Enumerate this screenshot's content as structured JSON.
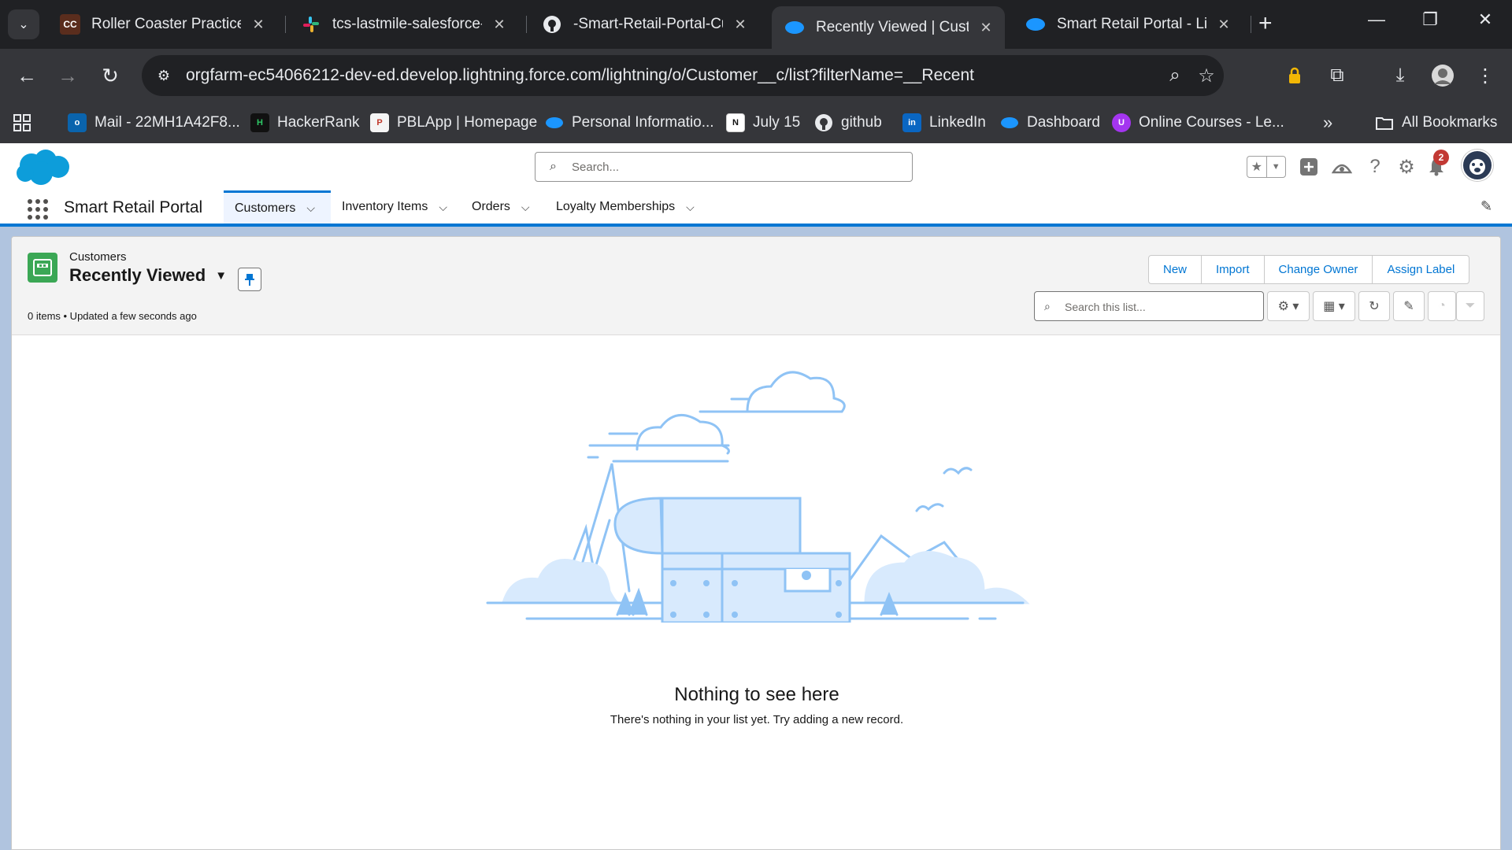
{
  "browser": {
    "tabs": [
      {
        "title": "Roller Coaster Practice Pr",
        "favicon": "CC",
        "close": "✕"
      },
      {
        "title": "tcs-lastmile-salesforce-ba",
        "favicon": "slack-icon",
        "close": "✕"
      },
      {
        "title": "-Smart-Retail-Portal-Cust",
        "favicon": "github-icon",
        "close": "✕"
      },
      {
        "title": "Recently Viewed | Custon",
        "favicon": "salesforce-icon",
        "close": "✕"
      },
      {
        "title": "Smart Retail Portal - Ligh",
        "favicon": "salesforce-icon",
        "close": "✕"
      }
    ],
    "new_tab": "+",
    "url": "orgfarm-ec54066212-dev-ed.develop.lightning.force.com/lightning/o/Customer__c/list?filterName=__Recent",
    "bookmarks": [
      {
        "label": "Mail - 22MH1A42F8..."
      },
      {
        "label": "HackerRank"
      },
      {
        "label": "PBLApp | Homepage"
      },
      {
        "label": "Personal Informatio..."
      },
      {
        "label": "July 15"
      },
      {
        "label": "github"
      },
      {
        "label": "LinkedIn"
      },
      {
        "label": "Dashboard"
      },
      {
        "label": "Online Courses - Le..."
      }
    ],
    "bookmarks_overflow": "»",
    "all_bookmarks": "All Bookmarks"
  },
  "sf": {
    "search_placeholder": "Search...",
    "notification_count": "2",
    "app_name": "Smart Retail Portal",
    "nav": [
      {
        "label": "Customers"
      },
      {
        "label": "Inventory Items"
      },
      {
        "label": "Orders"
      },
      {
        "label": "Loyalty Memberships"
      }
    ],
    "list": {
      "object_label": "Customers",
      "view_name": "Recently Viewed",
      "meta": "0 items • Updated a few seconds ago",
      "buttons": [
        "New",
        "Import",
        "Change Owner",
        "Assign Label"
      ],
      "search_placeholder": "Search this list...",
      "empty_title": "Nothing to see here",
      "empty_sub": "There's nothing in your list yet. Try adding a new record."
    }
  },
  "colors": {
    "brand": "#0176d3",
    "object_icon": "#3ba755",
    "illustration": "#8fc3f5",
    "illustration_fill": "#d8eafd"
  }
}
